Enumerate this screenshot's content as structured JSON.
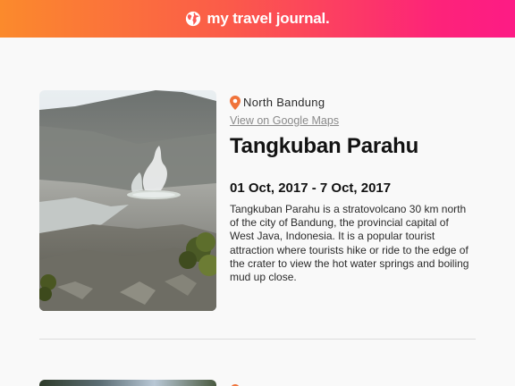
{
  "header": {
    "title": "my travel journal.",
    "icon": "globe-icon"
  },
  "entries": [
    {
      "location": "North Bandung",
      "location_icon": "location-pin-icon",
      "maps_link_label": "View on Google Maps",
      "title": "Tangkuban Parahu",
      "dates": "01 Oct, 2017 - 7 Oct, 2017",
      "description": "Tangkuban Parahu is a stratovolcano 30 km north of the city of Bandung, the provincial capital of West Java, Indonesia. It is a popular tourist attraction where tourists hike or ride to the edge of the crater to view the hot water springs and boiling mud up close.",
      "image": "volcano-crater-photo"
    }
  ],
  "colors": {
    "header_gradient_start": "#fb8a2c",
    "header_gradient_end": "#fd1b85",
    "pin": "#f0733a",
    "background": "#f9f9f9"
  }
}
